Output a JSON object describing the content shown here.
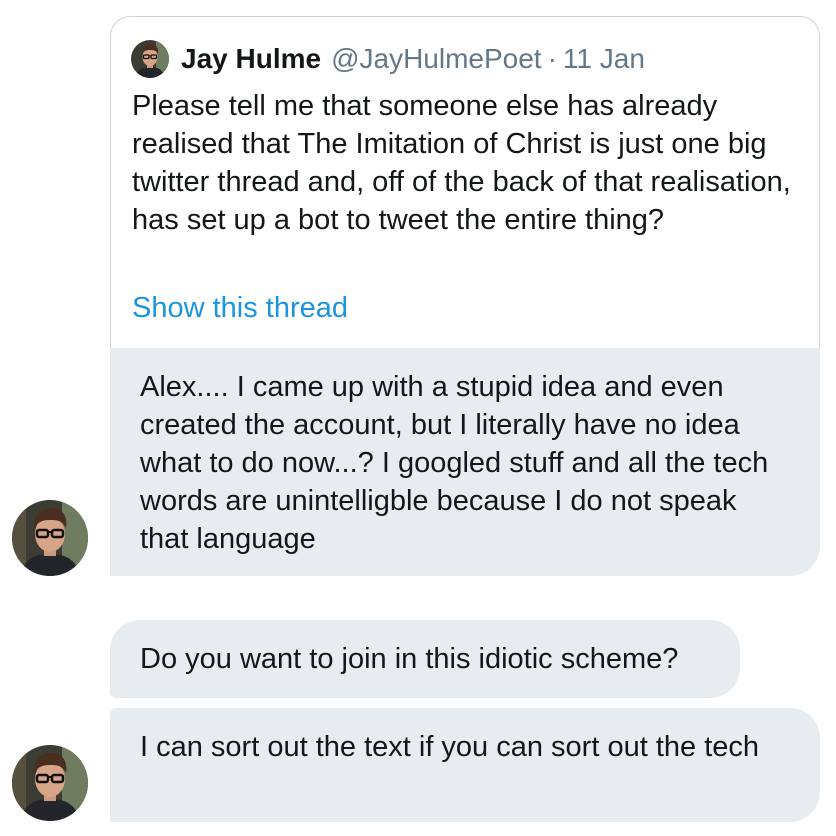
{
  "quoted_tweet": {
    "author_name": "Jay Hulme",
    "author_handle": "@JayHulmePoet",
    "separator": "·",
    "date": "11 Jan",
    "text": "Please tell me that someone else has already realised that The Imitation of Christ is just one big twitter thread and, off of the back of that realisation, has set up a bot to tweet the entire thing?",
    "show_thread_label": "Show this thread",
    "avatar_icon": "user-avatar-icon"
  },
  "messages": [
    {
      "text": "Alex.... I came up with a stupid idea and even created the account, but I literally have no idea what to do now...? I googled stuff and all the tech words are unintelligble because I do not speak that language"
    },
    {
      "text": "Do you want to join in this idiotic scheme?"
    },
    {
      "text": "I can sort out the text if you can sort out the tech"
    }
  ],
  "colors": {
    "bubble_bg": "#e6ecf0",
    "link": "#1b95e0",
    "secondary_text": "#657786",
    "card_border": "#c9d4dd"
  }
}
